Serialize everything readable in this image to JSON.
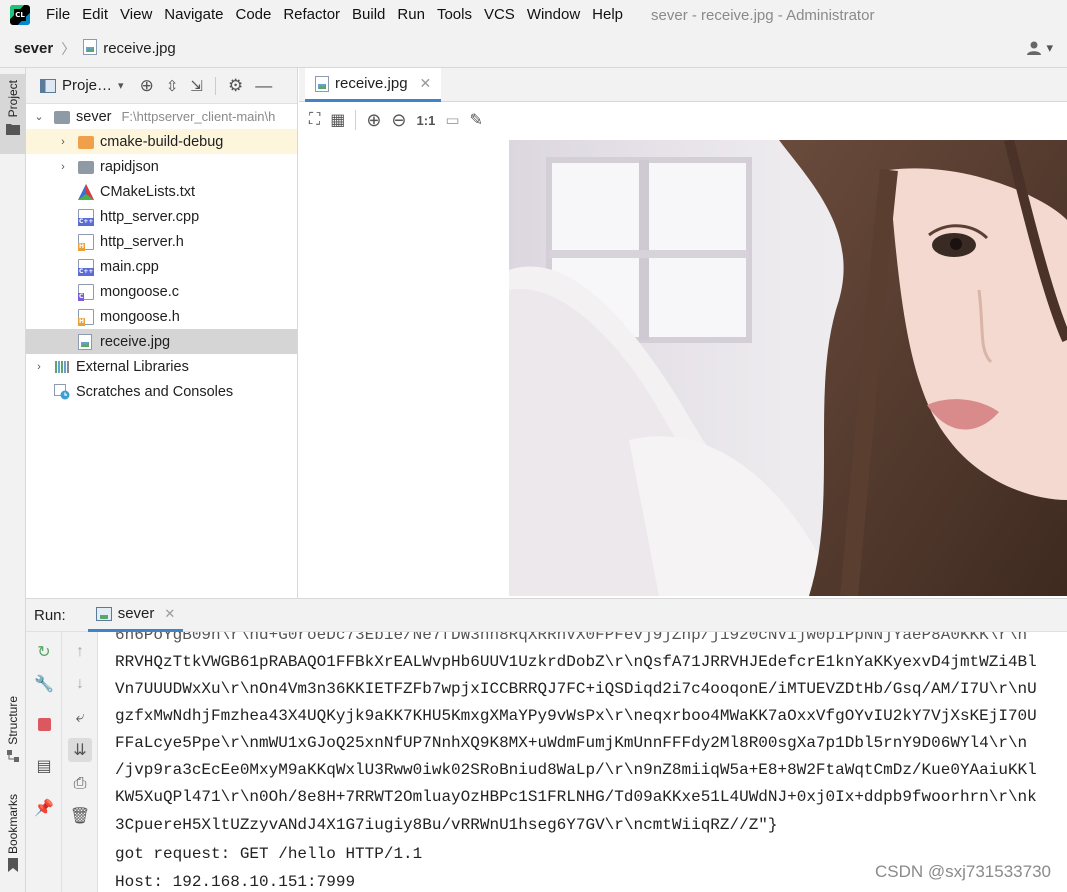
{
  "menu": {
    "logo_text": "CL",
    "items": [
      "File",
      "Edit",
      "View",
      "Navigate",
      "Code",
      "Refactor",
      "Build",
      "Run",
      "Tools",
      "VCS",
      "Window",
      "Help"
    ],
    "window_title": "sever - receive.jpg - Administrator"
  },
  "nav": {
    "project": "sever",
    "file": "receive.jpg"
  },
  "left_stripe": {
    "project": "Project",
    "structure": "Structure",
    "bookmarks": "Bookmarks"
  },
  "project_pane": {
    "title": "Proje…",
    "root": {
      "name": "sever",
      "path": "F:\\httpserver_client-main\\h"
    },
    "items": [
      {
        "name": "cmake-build-debug",
        "type": "folder-orange"
      },
      {
        "name": "rapidjson",
        "type": "folder"
      },
      {
        "name": "CMakeLists.txt",
        "type": "cmake"
      },
      {
        "name": "http_server.cpp",
        "type": "cpp"
      },
      {
        "name": "http_server.h",
        "type": "h"
      },
      {
        "name": "main.cpp",
        "type": "cpp"
      },
      {
        "name": "mongoose.c",
        "type": "c"
      },
      {
        "name": "mongoose.h",
        "type": "h"
      },
      {
        "name": "receive.jpg",
        "type": "image"
      }
    ],
    "external_libraries": "External Libraries",
    "scratches": "Scratches and Consoles"
  },
  "editor": {
    "tab": "receive.jpg",
    "zoom_actual": "1:1"
  },
  "run": {
    "label": "Run:",
    "tab": "sever",
    "lines": [
      "6n6PoYgB09n\\r\\nd+G0roeDc73Eb1e/Ne7fDW3nn8RqXRRnVX0FPFevj9jZnp/j1920cNV1jw0p1PpNNjYaeP8A0KKK\\r\\n",
      "RRVHQzTtkVWGB61pRABAQO1FFBkXrEALWvpHb6UUV1UzkrdDobZ\\r\\nQsfA71JRRVHJEdefcrE1knYaKKyexvD4jmtWZi4Bl",
      "Vn7UUUDWxXu\\r\\nOn4Vm3n36KKIETFZFb7wpjxICCBRRQJ7FC+iQSDiqd2i7c4ooqonE/iMTUEVZDtHb/Gsq/AM/I7U\\r\\nU",
      "gzfxMwNdhjFmzhea43X4UQKyjk9aKK7KHU5KmxgXMaYPy9vWsPx\\r\\neqxrboo4MWaKK7aOxxVfgOYvIU2kY7VjXsKEjI70U",
      "FFaLcye5Ppe\\r\\nmWU1xGJoQ25xnNfUP7NnhXQ9K8MX+uWdmFumjKmUnnFFFdy2Ml8R00sgXa7p1Dbl5rnY9D06WYl4\\r\\n",
      "/jvp9ra3cEcEe0MxyM9aKKqWxlU3Rww0iwk02SRoBniud8WaLp/\\r\\n9nZ8miiqW5a+E8+8W2FtaWqtCmDz/Kue0YAaiuKKl",
      "KW5XuQPl471\\r\\n0Oh/8e8H+7RRWT2OmluayOzHBPc1S1FRLNHG/Td09aKKxe51L4UWdNJ+0xj0Ix+ddpb9fwoorhrn\\r\\nk",
      "3CpuereH5XltUZzyvANdJ4X1G7iugiy8Bu/vRRWnU1hseg6Y7GV\\r\\ncmtWiiqRZ//Z\"}",
      "got request: GET /hello HTTP/1.1",
      "Host: 192.168.10.151:7999"
    ]
  },
  "watermark": "CSDN @sxj731533730",
  "colors": {
    "accent": "#4083c9",
    "run_green": "#59a869",
    "stop_red": "#db5860",
    "selection": "#d5d5d5"
  }
}
